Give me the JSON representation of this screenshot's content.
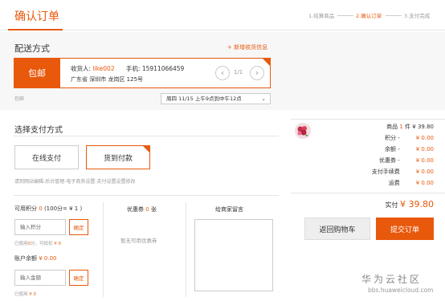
{
  "header": {
    "title": "确认订单",
    "steps": [
      "1.结算商品",
      "2.确认订单",
      "3.支付完成"
    ]
  },
  "delivery": {
    "heading": "配送方式",
    "add_address": "+ 新增收货信息",
    "shipping_tag": "包邮",
    "receiver_label": "收货人:",
    "receiver_name": "like002",
    "phone_label": "手机:",
    "phone": "15911066459",
    "address": "广东省 深圳市 龙岗区 125号",
    "pager": "1/1",
    "note_label": "包邮",
    "time_value": "周四 11/15 上午9点到中午12点"
  },
  "payment": {
    "heading": "选择支付方式",
    "online_label": "在线支付",
    "cod_label": "货到付款",
    "selected": "货到付款",
    "hint": "请到网站编辑-后台管理-电子商务设置-支付设置设置修改",
    "points_label": "可用积分",
    "points_value": "0",
    "points_rate": "(100分= ¥ 1 )",
    "points_placeholder": "输入积分",
    "confirm_label": "确定",
    "points_used_prefix": "已使用",
    "points_used": "0",
    "points_deduct_prefix": "分，可抵扣",
    "points_deduct": "¥ 0",
    "balance_label": "账户余额",
    "balance_value": "¥ 0.00",
    "balance_placeholder": "输入金额",
    "balance_used_prefix": "已使用",
    "balance_used": "¥ 0"
  },
  "coupon": {
    "label": "优惠券",
    "count": "0",
    "unit": "张",
    "empty": "暂无可用优惠券"
  },
  "message": {
    "label": "给商家留言"
  },
  "summary": {
    "goods_label": "商品",
    "goods_count": "1",
    "goods_unit": "件",
    "goods_amount": "¥ 39.80",
    "rows": [
      {
        "label": "积分 -",
        "value": "¥ 0.00"
      },
      {
        "label": "余额 -",
        "value": "¥ 0.00"
      },
      {
        "label": "优惠券 -",
        "value": "¥ 0.00"
      },
      {
        "label": "支付手续费",
        "value": "¥ 0.00"
      },
      {
        "label": "运费",
        "value": "¥ 0.00"
      }
    ],
    "total_label": "实付",
    "total_value": "¥ 39.80",
    "back_button": "返回购物车",
    "submit_button": "提交订单"
  },
  "watermark": {
    "text": "华为云社区",
    "url": "bbs.huaweicloud.com"
  },
  "colors": {
    "accent": "#e8590c",
    "border": "#cccccc",
    "muted": "#999999"
  }
}
